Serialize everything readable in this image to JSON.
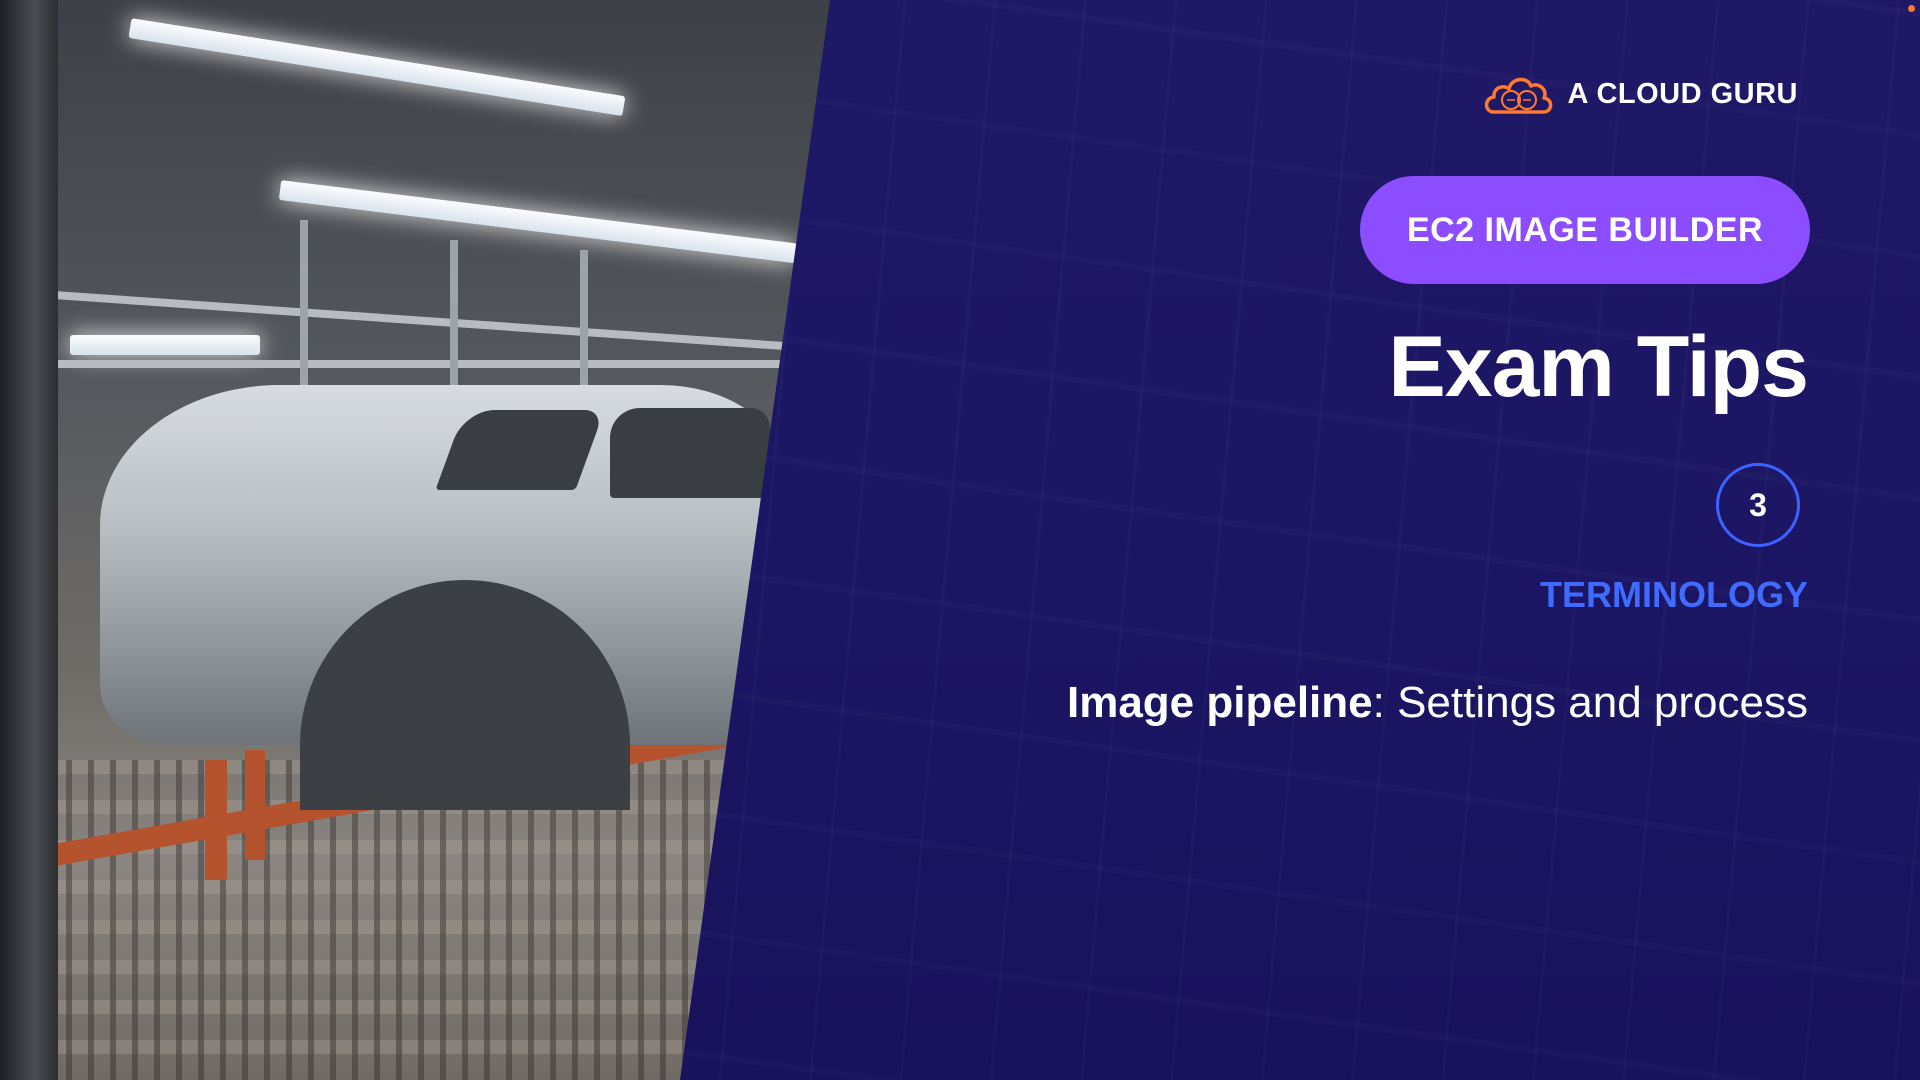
{
  "brand": {
    "logo_icon": "cloud-guru-icon",
    "name": "A CLOUD GURU",
    "accent_color": "#ff7a2f"
  },
  "course": {
    "badge": "EC2 IMAGE BUILDER",
    "badge_color": "#8b4dff"
  },
  "slide": {
    "title": "Exam Tips",
    "step_number": "3",
    "section": "TERMINOLOGY",
    "section_color": "#3f6bff",
    "tip_term": "Image pipeline",
    "tip_separator": ":",
    "tip_text": " Settings and process"
  },
  "colors": {
    "panel_background": "#1c1563"
  }
}
